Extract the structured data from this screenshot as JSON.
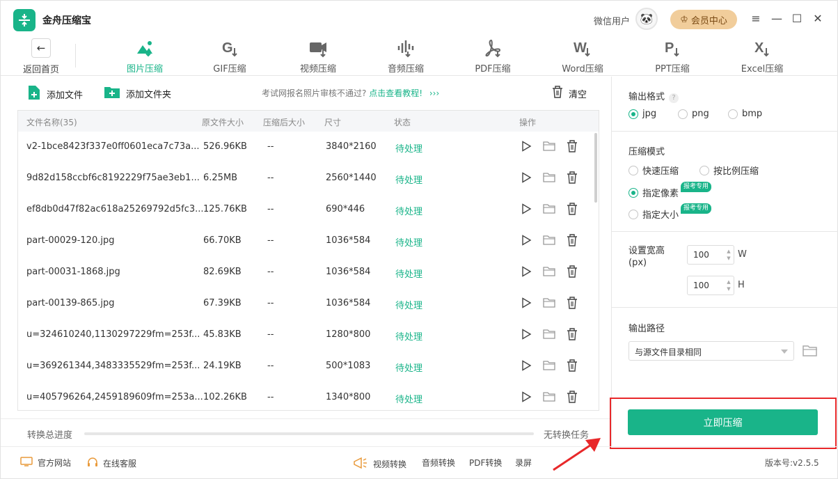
{
  "app": {
    "title": "金舟压缩宝",
    "user": "微信用户",
    "vip": "会员中心",
    "version_label": "版本号:",
    "version": "v2.5.5"
  },
  "toolbar": {
    "back": "返回首页",
    "tools": [
      {
        "label": "图片压缩",
        "icon": "image-compress-icon",
        "active": true
      },
      {
        "label": "GIF压缩",
        "icon": "gif-compress-icon"
      },
      {
        "label": "视频压缩",
        "icon": "video-compress-icon"
      },
      {
        "label": "音频压缩",
        "icon": "audio-compress-icon"
      },
      {
        "label": "PDF压缩",
        "icon": "pdf-compress-icon"
      },
      {
        "label": "Word压缩",
        "icon": "word-compress-icon"
      },
      {
        "label": "PPT压缩",
        "icon": "ppt-compress-icon"
      },
      {
        "label": "Excel压缩",
        "icon": "excel-compress-icon"
      }
    ]
  },
  "actions": {
    "add_file": "添加文件",
    "add_folder": "添加文件夹",
    "notice": "考试网报名照片审核不通过?",
    "notice_link": "点击查看教程!",
    "notice_arrows": "›››",
    "clear": "清空"
  },
  "table": {
    "columns": [
      "文件名称(35)",
      "原文件大小",
      "压缩后大小",
      "尺寸",
      "状态",
      "操作"
    ],
    "rows": [
      {
        "name": "v2-1bce8423f337e0ff0601eca7c73a...",
        "size": "526.96KB",
        "after": "--",
        "dim": "3840*2160",
        "status": "待处理"
      },
      {
        "name": "9d82d158ccbf6c8192229f75ae3eb1...",
        "size": "6.25MB",
        "after": "--",
        "dim": "2560*1440",
        "status": "待处理"
      },
      {
        "name": "ef8db0d47f82ac618a25269792d5fc3...",
        "size": "125.76KB",
        "after": "--",
        "dim": "690*446",
        "status": "待处理"
      },
      {
        "name": "part-00029-120.jpg",
        "size": "66.70KB",
        "after": "--",
        "dim": "1036*584",
        "status": "待处理"
      },
      {
        "name": "part-00031-1868.jpg",
        "size": "82.69KB",
        "after": "--",
        "dim": "1036*584",
        "status": "待处理"
      },
      {
        "name": "part-00139-865.jpg",
        "size": "67.39KB",
        "after": "--",
        "dim": "1036*584",
        "status": "待处理"
      },
      {
        "name": "u=324610240,1130297229fm=253f...",
        "size": "45.83KB",
        "after": "--",
        "dim": "1280*800",
        "status": "待处理"
      },
      {
        "name": "u=369261344,3483335529fm=253f...",
        "size": "24.19KB",
        "after": "--",
        "dim": "500*1083",
        "status": "待处理"
      },
      {
        "name": "u=405796264,2459189609fm=253a...",
        "size": "102.26KB",
        "after": "--",
        "dim": "1340*800",
        "status": "待处理"
      }
    ]
  },
  "progress": {
    "label": "转换总进度",
    "status": "无转换任务",
    "value": 0
  },
  "panel": {
    "format_title": "输出格式",
    "formats": [
      {
        "label": "jpg",
        "checked": true
      },
      {
        "label": "png",
        "checked": false
      },
      {
        "label": "bmp",
        "checked": false
      }
    ],
    "mode_title": "压缩模式",
    "modes": [
      {
        "label": "快速压缩",
        "checked": false
      },
      {
        "label": "按比例压缩",
        "checked": false
      },
      {
        "label": "指定像素",
        "checked": true
      },
      {
        "label": "指定大小",
        "checked": false
      }
    ],
    "badge": "报考专用",
    "size_title": "设置宽高",
    "size_unit": "(px)",
    "width": "100",
    "height": "100",
    "w": "W",
    "h": "H",
    "path_title": "输出路径",
    "path_value": "与源文件目录相同",
    "compress": "立即压缩"
  },
  "footer": {
    "website": "官方网站",
    "service": "在线客服",
    "video": "视频转换",
    "audio": "音频转换",
    "pdf": "PDF转换",
    "record": "录屏"
  },
  "colors": {
    "accent": "#19b489",
    "highlight": "#e8282a",
    "vip": "#f1cd9b"
  }
}
